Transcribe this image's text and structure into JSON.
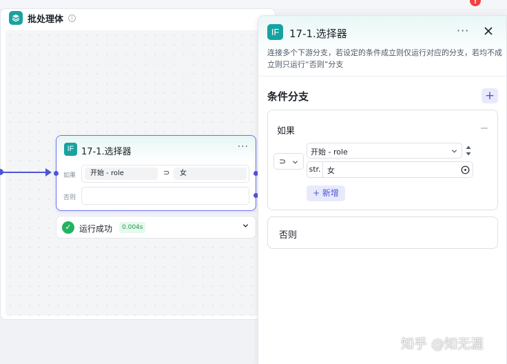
{
  "batch": {
    "title": "批处理体",
    "icon": "layers-icon",
    "info_icon": "i"
  },
  "node": {
    "icon_text": "IF",
    "title": "17-1.选择器",
    "more": "···",
    "if_label": "如果",
    "else_label": "否则",
    "cond_left": "开始 - role",
    "operator": "⊃",
    "cond_right": "女"
  },
  "run": {
    "status": "运行成功",
    "time": "0.004s"
  },
  "panel": {
    "icon_text": "IF",
    "title": "17-1.选择器",
    "more": "···",
    "description": "连接多个下游分支，若设定的条件成立则仅运行对应的分支，若均不成立则只运行“否则”分支",
    "section_title": "条件分支",
    "add_symbol": "+",
    "if_block": {
      "label": "如果",
      "operator": "⊃",
      "left_value": "开始 - role",
      "right_type": "str.",
      "right_value": "女",
      "add_button": "+ 新增"
    },
    "else_block": {
      "label": "否则"
    }
  },
  "notification_count": "!",
  "watermark": "知乎 @知无涯",
  "colors": {
    "accent": "#4e55d6",
    "teal": "#17a2a2",
    "success": "#22b35e"
  }
}
